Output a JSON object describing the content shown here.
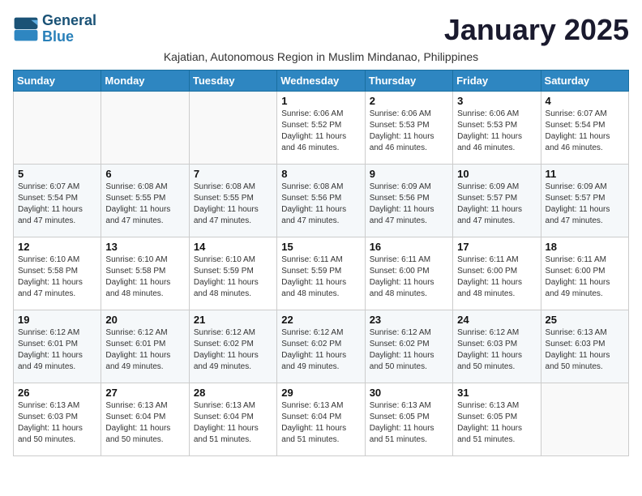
{
  "logo": {
    "line1": "General",
    "line2": "Blue"
  },
  "title": "January 2025",
  "subtitle": "Kajatian, Autonomous Region in Muslim Mindanao, Philippines",
  "weekdays": [
    "Sunday",
    "Monday",
    "Tuesday",
    "Wednesday",
    "Thursday",
    "Friday",
    "Saturday"
  ],
  "weeks": [
    [
      {
        "day": "",
        "info": ""
      },
      {
        "day": "",
        "info": ""
      },
      {
        "day": "",
        "info": ""
      },
      {
        "day": "1",
        "info": "Sunrise: 6:06 AM\nSunset: 5:52 PM\nDaylight: 11 hours\nand 46 minutes."
      },
      {
        "day": "2",
        "info": "Sunrise: 6:06 AM\nSunset: 5:53 PM\nDaylight: 11 hours\nand 46 minutes."
      },
      {
        "day": "3",
        "info": "Sunrise: 6:06 AM\nSunset: 5:53 PM\nDaylight: 11 hours\nand 46 minutes."
      },
      {
        "day": "4",
        "info": "Sunrise: 6:07 AM\nSunset: 5:54 PM\nDaylight: 11 hours\nand 46 minutes."
      }
    ],
    [
      {
        "day": "5",
        "info": "Sunrise: 6:07 AM\nSunset: 5:54 PM\nDaylight: 11 hours\nand 47 minutes."
      },
      {
        "day": "6",
        "info": "Sunrise: 6:08 AM\nSunset: 5:55 PM\nDaylight: 11 hours\nand 47 minutes."
      },
      {
        "day": "7",
        "info": "Sunrise: 6:08 AM\nSunset: 5:55 PM\nDaylight: 11 hours\nand 47 minutes."
      },
      {
        "day": "8",
        "info": "Sunrise: 6:08 AM\nSunset: 5:56 PM\nDaylight: 11 hours\nand 47 minutes."
      },
      {
        "day": "9",
        "info": "Sunrise: 6:09 AM\nSunset: 5:56 PM\nDaylight: 11 hours\nand 47 minutes."
      },
      {
        "day": "10",
        "info": "Sunrise: 6:09 AM\nSunset: 5:57 PM\nDaylight: 11 hours\nand 47 minutes."
      },
      {
        "day": "11",
        "info": "Sunrise: 6:09 AM\nSunset: 5:57 PM\nDaylight: 11 hours\nand 47 minutes."
      }
    ],
    [
      {
        "day": "12",
        "info": "Sunrise: 6:10 AM\nSunset: 5:58 PM\nDaylight: 11 hours\nand 47 minutes."
      },
      {
        "day": "13",
        "info": "Sunrise: 6:10 AM\nSunset: 5:58 PM\nDaylight: 11 hours\nand 48 minutes."
      },
      {
        "day": "14",
        "info": "Sunrise: 6:10 AM\nSunset: 5:59 PM\nDaylight: 11 hours\nand 48 minutes."
      },
      {
        "day": "15",
        "info": "Sunrise: 6:11 AM\nSunset: 5:59 PM\nDaylight: 11 hours\nand 48 minutes."
      },
      {
        "day": "16",
        "info": "Sunrise: 6:11 AM\nSunset: 6:00 PM\nDaylight: 11 hours\nand 48 minutes."
      },
      {
        "day": "17",
        "info": "Sunrise: 6:11 AM\nSunset: 6:00 PM\nDaylight: 11 hours\nand 48 minutes."
      },
      {
        "day": "18",
        "info": "Sunrise: 6:11 AM\nSunset: 6:00 PM\nDaylight: 11 hours\nand 49 minutes."
      }
    ],
    [
      {
        "day": "19",
        "info": "Sunrise: 6:12 AM\nSunset: 6:01 PM\nDaylight: 11 hours\nand 49 minutes."
      },
      {
        "day": "20",
        "info": "Sunrise: 6:12 AM\nSunset: 6:01 PM\nDaylight: 11 hours\nand 49 minutes."
      },
      {
        "day": "21",
        "info": "Sunrise: 6:12 AM\nSunset: 6:02 PM\nDaylight: 11 hours\nand 49 minutes."
      },
      {
        "day": "22",
        "info": "Sunrise: 6:12 AM\nSunset: 6:02 PM\nDaylight: 11 hours\nand 49 minutes."
      },
      {
        "day": "23",
        "info": "Sunrise: 6:12 AM\nSunset: 6:02 PM\nDaylight: 11 hours\nand 50 minutes."
      },
      {
        "day": "24",
        "info": "Sunrise: 6:12 AM\nSunset: 6:03 PM\nDaylight: 11 hours\nand 50 minutes."
      },
      {
        "day": "25",
        "info": "Sunrise: 6:13 AM\nSunset: 6:03 PM\nDaylight: 11 hours\nand 50 minutes."
      }
    ],
    [
      {
        "day": "26",
        "info": "Sunrise: 6:13 AM\nSunset: 6:03 PM\nDaylight: 11 hours\nand 50 minutes."
      },
      {
        "day": "27",
        "info": "Sunrise: 6:13 AM\nSunset: 6:04 PM\nDaylight: 11 hours\nand 50 minutes."
      },
      {
        "day": "28",
        "info": "Sunrise: 6:13 AM\nSunset: 6:04 PM\nDaylight: 11 hours\nand 51 minutes."
      },
      {
        "day": "29",
        "info": "Sunrise: 6:13 AM\nSunset: 6:04 PM\nDaylight: 11 hours\nand 51 minutes."
      },
      {
        "day": "30",
        "info": "Sunrise: 6:13 AM\nSunset: 6:05 PM\nDaylight: 11 hours\nand 51 minutes."
      },
      {
        "day": "31",
        "info": "Sunrise: 6:13 AM\nSunset: 6:05 PM\nDaylight: 11 hours\nand 51 minutes."
      },
      {
        "day": "",
        "info": ""
      }
    ]
  ]
}
